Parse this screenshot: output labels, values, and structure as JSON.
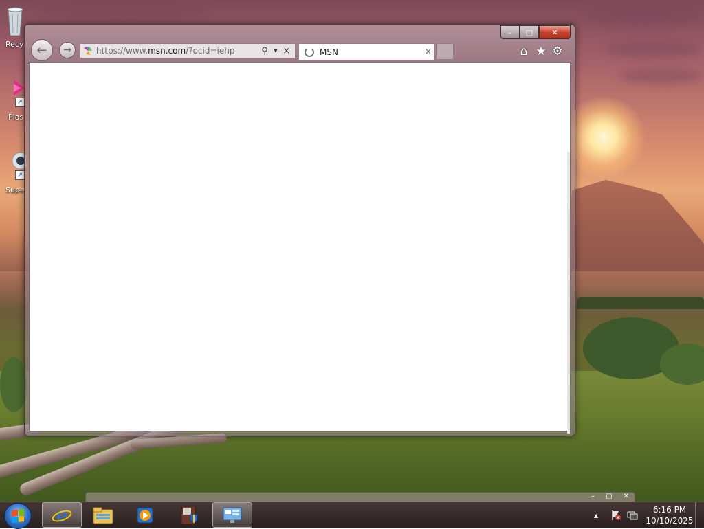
{
  "desktop": {
    "icons": [
      {
        "name": "recycle-bin",
        "label": "Recy"
      },
      {
        "name": "plasma-shortcut",
        "label": "Plas"
      },
      {
        "name": "super-shortcut",
        "label": "Supe"
      }
    ]
  },
  "browser": {
    "address_prefix": "https://www.",
    "address_domain": "msn.com",
    "address_suffix": "/?ocid=iehp",
    "tab_title": "MSN",
    "tab_close": "×",
    "stop_glyph": "×",
    "search_glyph": "⚲",
    "dropdown_glyph": "▾",
    "home_glyph": "⌂",
    "favorites_glyph": "★",
    "settings_glyph": "⚙",
    "back_glyph": "←",
    "forward_glyph": "→",
    "minimize_glyph": "–",
    "maximize_glyph": "□",
    "close_glyph": "✕"
  },
  "mini_window": {
    "minimize_glyph": "–",
    "maximize_glyph": "□",
    "close_glyph": "✕"
  },
  "taskbar": {
    "pinned": [
      {
        "name": "internet-explorer",
        "active": true
      },
      {
        "name": "file-explorer",
        "active": false
      },
      {
        "name": "media-player",
        "active": false
      },
      {
        "name": "security-app",
        "active": false
      },
      {
        "name": "remote-desktop",
        "active": true
      }
    ],
    "tray_expand": "▲",
    "time": "6:16 PM",
    "date": "10/10/2025"
  },
  "colors": {
    "close_red": "#c7432f",
    "ie_blue": "#1f7be0",
    "start_blue": "#2d6bc1"
  }
}
